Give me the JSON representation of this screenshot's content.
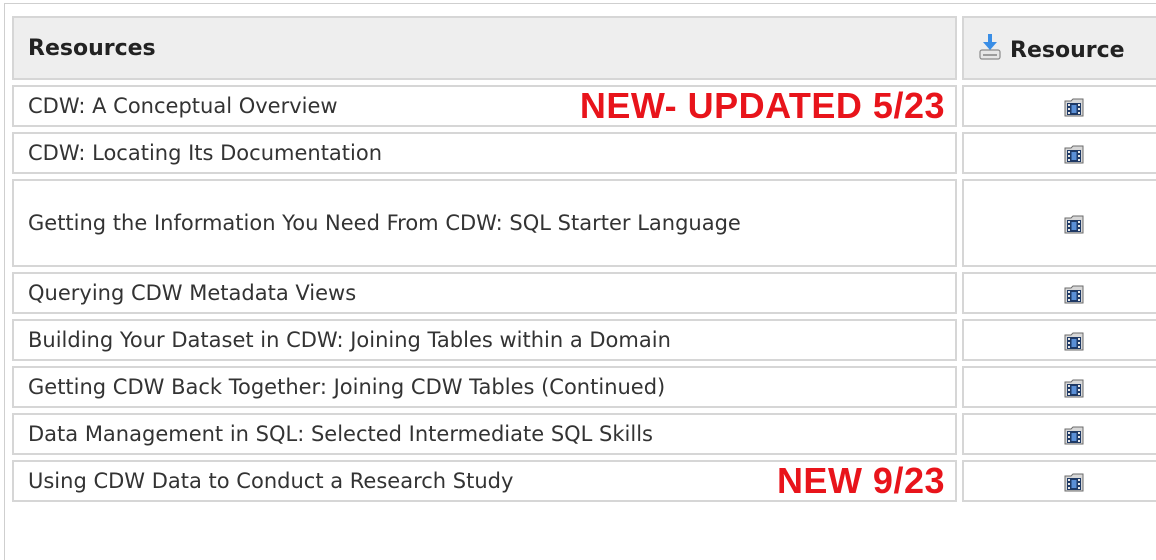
{
  "table": {
    "header": {
      "resources_label": "Resources",
      "resource_column_label": "Resource",
      "resource_column_icon": "download-icon"
    },
    "rows": [
      {
        "title": "CDW: A Conceptual Overview",
        "badge": "NEW- UPDATED 5/23",
        "resource_icon": "video-file-icon"
      },
      {
        "title": "CDW: Locating Its Documentation",
        "badge": "",
        "resource_icon": "video-file-icon"
      },
      {
        "title": "Getting the Information You Need From CDW: SQL Starter Language",
        "badge": "",
        "resource_icon": "video-file-icon"
      },
      {
        "title": "Querying CDW Metadata Views",
        "badge": "",
        "resource_icon": "video-file-icon"
      },
      {
        "title": "Building Your Dataset in CDW: Joining Tables within a Domain",
        "badge": "",
        "resource_icon": "video-file-icon"
      },
      {
        "title": "Getting CDW Back Together: Joining CDW Tables (Continued)",
        "badge": "",
        "resource_icon": "video-file-icon"
      },
      {
        "title": "Data Management in SQL: Selected Intermediate SQL Skills",
        "badge": "",
        "resource_icon": "video-file-icon"
      },
      {
        "title": "Using CDW Data to Conduct a Research Study",
        "badge": "NEW 9/23",
        "resource_icon": "video-file-icon"
      }
    ]
  },
  "colors": {
    "badge": "#e8141b",
    "header_bg": "#eeeeee",
    "border": "#d6d6d6",
    "text": "#333333"
  }
}
